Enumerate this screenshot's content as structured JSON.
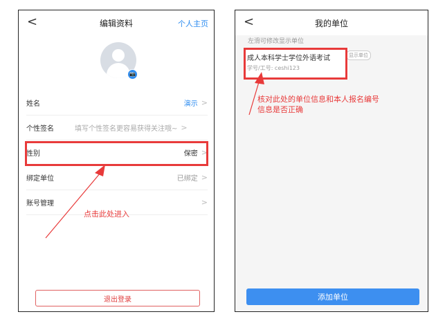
{
  "screen1": {
    "nav": {
      "back": "<",
      "title": "编辑资料",
      "right_link": "个人主页"
    },
    "avatar_badge": "📷",
    "rows": [
      {
        "label": "姓名",
        "value": "演示",
        "chev": ">"
      },
      {
        "label": "个性签名",
        "placeholder": "填写个性签名更容易获得关注哦~",
        "chev": ">"
      },
      {
        "label": "性别",
        "value": "保密",
        "chev": ">"
      },
      {
        "label": "绑定单位",
        "value": "已绑定",
        "chev": ">"
      },
      {
        "label": "账号管理",
        "chev": ">"
      }
    ],
    "annotation": "点击此处进入",
    "logout_label": "退出登录"
  },
  "screen2": {
    "nav": {
      "back": "<",
      "title": "我的单位"
    },
    "hint": "左滑可修改显示单位",
    "unit": {
      "name": "成人本科学士学位外语考试",
      "tag": "显示单位",
      "id_line": "学号/工号: ceshi123"
    },
    "annotation_line1": "核对此处的单位信息和本人报名编号",
    "annotation_line2": "信息是否正确",
    "add_label": "添加单位"
  },
  "colors": {
    "accent": "#2d8cf0",
    "annotation_red": "#e83a3a",
    "button_blue": "#3d8ff0"
  }
}
